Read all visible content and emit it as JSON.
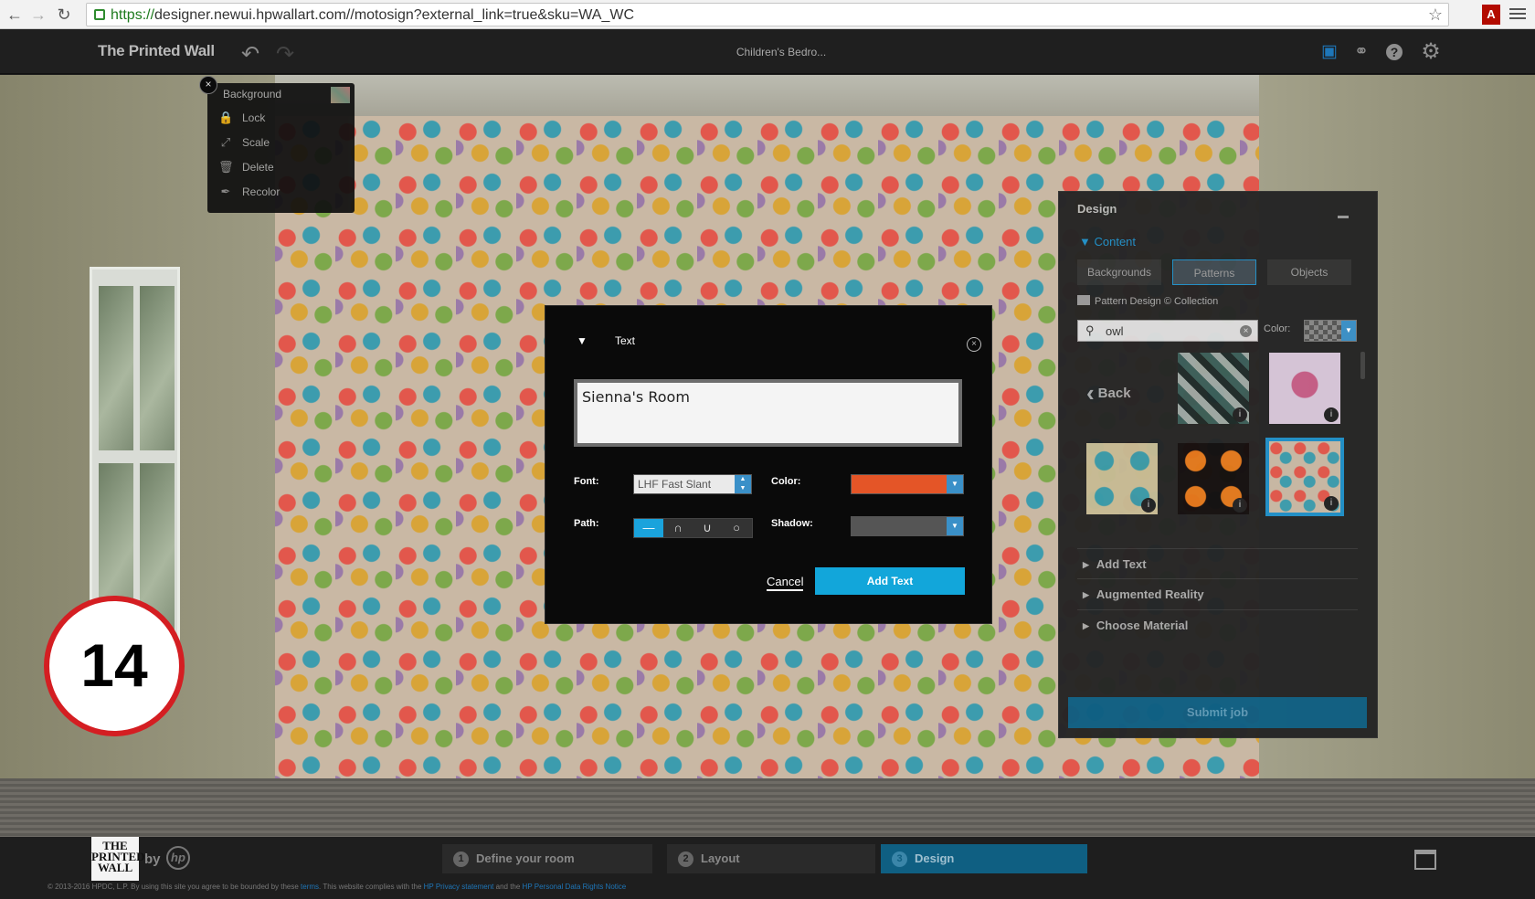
{
  "browser": {
    "url_proto": "https://",
    "url_rest": "designer.newui.hpwallart.com//motosign?external_link=true&sku=WA_WC"
  },
  "app": {
    "brand": "The Printed Wall",
    "doc_title": "Children's Bedro..."
  },
  "context_menu": {
    "title": "Background",
    "items": [
      {
        "label": "Lock",
        "icon": "lock-icon"
      },
      {
        "label": "Scale",
        "icon": "scale-icon"
      },
      {
        "label": "Delete",
        "icon": "trash-icon"
      },
      {
        "label": "Recolor",
        "icon": "eyedropper-icon"
      }
    ]
  },
  "text_dialog": {
    "title": "Text",
    "text_value": "Sienna's Room",
    "font_label": "Font:",
    "font_value": "LHF Fast Slant",
    "color_label": "Color:",
    "color_value": "#e45527",
    "path_label": "Path:",
    "shadow_label": "Shadow:",
    "cancel_label": "Cancel",
    "add_label": "Add Text"
  },
  "design_panel": {
    "title": "Design",
    "content_label": "Content",
    "tabs": [
      {
        "label": "Backgrounds"
      },
      {
        "label": "Patterns",
        "active": true
      },
      {
        "label": "Objects"
      }
    ],
    "collection": "Pattern Design © Collection",
    "search_value": "owl",
    "color_label": "Color:",
    "back_label": "Back",
    "sections": [
      "Add Text",
      "Augmented Reality",
      "Choose Material"
    ],
    "submit_label": "Submit job"
  },
  "badge": {
    "number": "14"
  },
  "footer": {
    "logo_text": "THE PRINTED WALL",
    "by": "by",
    "hp": "hp",
    "steps": [
      {
        "num": "1",
        "label": "Define your room"
      },
      {
        "num": "2",
        "label": "Layout"
      },
      {
        "num": "3",
        "label": "Design",
        "active": true
      }
    ],
    "copyright_a": "© 2013-2016 HPDC, L.P.  By using this site you agree to be bounded by these ",
    "terms": "terms",
    "copyright_b": ". This website complies with the ",
    "privacy": "HP Privacy statement",
    "copyright_c": " and the ",
    "rights": "HP Personal Data Rights Notice"
  }
}
